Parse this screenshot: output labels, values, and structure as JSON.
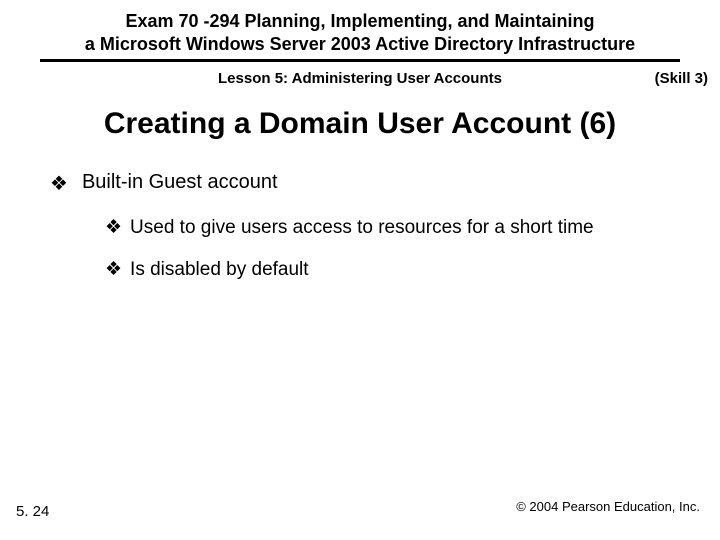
{
  "header": {
    "line1": "Exam 70 -294 Planning, Implementing, and Maintaining",
    "line2": "a Microsoft Windows Server 2003 Active Directory Infrastructure"
  },
  "lesson": "Lesson 5: Administering User Accounts",
  "skill": "(Skill 3)",
  "title": "Creating a Domain User Account (6)",
  "bullet_glyph": "❖",
  "items": {
    "top": "Built-in Guest account",
    "sub1": "Used to give users access to resources for a short time",
    "sub2": "Is disabled by default"
  },
  "page_number": "5. 24",
  "copyright": "© 2004 Pearson Education, Inc."
}
